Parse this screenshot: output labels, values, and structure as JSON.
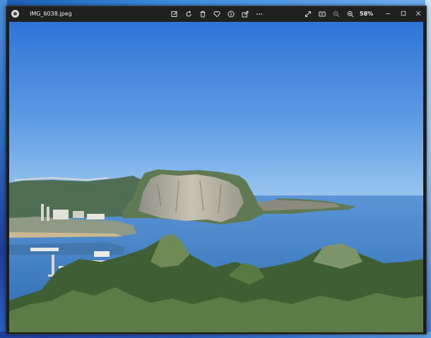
{
  "window": {
    "file_name": "IMG_6038.jpeg",
    "zoom": "58%"
  },
  "toolbar": {
    "icons": [
      "edit-image-icon",
      "rotate-icon",
      "delete-icon",
      "favorite-icon",
      "info-icon",
      "share-icon",
      "more-icon"
    ]
  },
  "view_controls": {
    "icons": [
      "fullscreen-icon",
      "slideshow-icon",
      "zoom-out-icon",
      "zoom-in-icon"
    ]
  },
  "window_controls": {
    "icons": [
      "minimize-icon",
      "maximize-icon",
      "close-icon"
    ]
  },
  "colors": {
    "titlebar": "#202020",
    "sky_top": "#2f74d8",
    "sky_bottom": "#8fc0ee",
    "sea": "#3a79c0"
  }
}
